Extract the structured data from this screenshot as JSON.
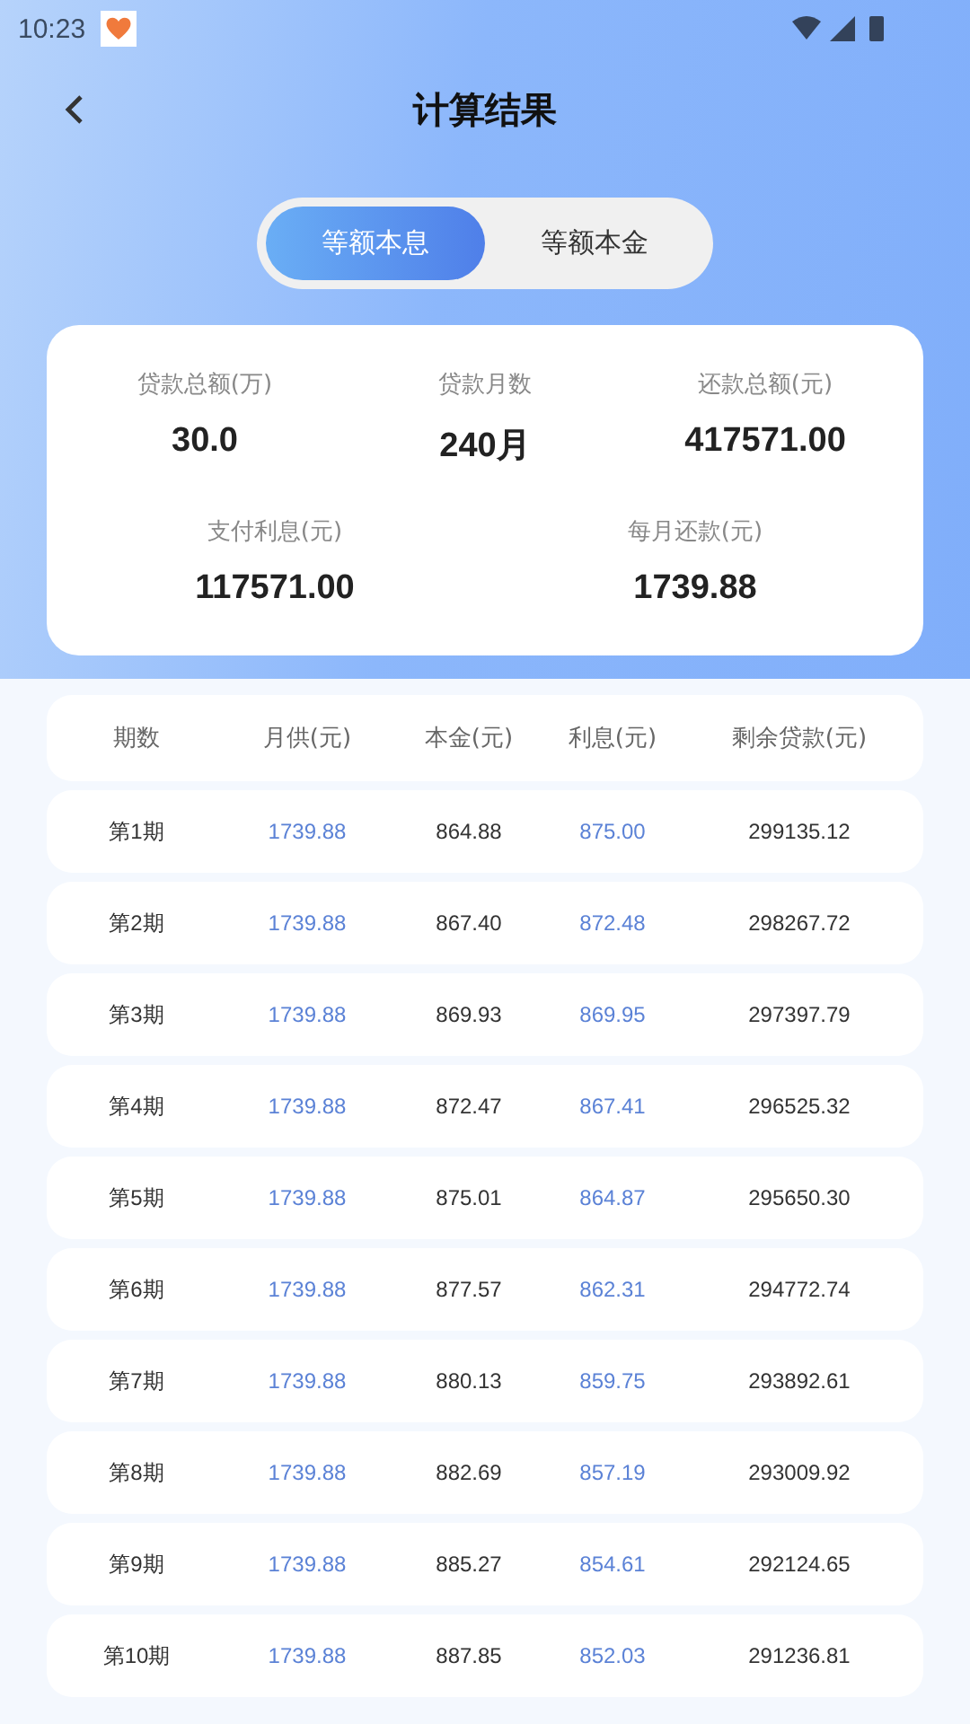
{
  "status_bar": {
    "time": "10:23"
  },
  "header": {
    "title": "计算结果"
  },
  "tabs": [
    {
      "label": "等额本息",
      "selected": true
    },
    {
      "label": "等额本金",
      "selected": false
    }
  ],
  "summary": [
    {
      "label": "贷款总额(万)",
      "value": "30.0"
    },
    {
      "label": "贷款月数",
      "value": "240月"
    },
    {
      "label": "还款总额(元)",
      "value": "417571.00"
    },
    {
      "label": "支付利息(元)",
      "value": "117571.00"
    },
    {
      "label": "每月还款(元)",
      "value": "1739.88"
    }
  ],
  "table": {
    "columns": [
      "期数",
      "月供(元)",
      "本金(元)",
      "利息(元)",
      "剩余贷款(元)"
    ],
    "rows": [
      [
        "第1期",
        "1739.88",
        "864.88",
        "875.00",
        "299135.12"
      ],
      [
        "第2期",
        "1739.88",
        "867.40",
        "872.48",
        "298267.72"
      ],
      [
        "第3期",
        "1739.88",
        "869.93",
        "869.95",
        "297397.79"
      ],
      [
        "第4期",
        "1739.88",
        "872.47",
        "867.41",
        "296525.32"
      ],
      [
        "第5期",
        "1739.88",
        "875.01",
        "864.87",
        "295650.30"
      ],
      [
        "第6期",
        "1739.88",
        "877.57",
        "862.31",
        "294772.74"
      ],
      [
        "第7期",
        "1739.88",
        "880.13",
        "859.75",
        "293892.61"
      ],
      [
        "第8期",
        "1739.88",
        "882.69",
        "857.19",
        "293009.92"
      ],
      [
        "第9期",
        "1739.88",
        "885.27",
        "854.61",
        "292124.65"
      ],
      [
        "第10期",
        "1739.88",
        "887.85",
        "852.03",
        "291236.81"
      ]
    ]
  }
}
